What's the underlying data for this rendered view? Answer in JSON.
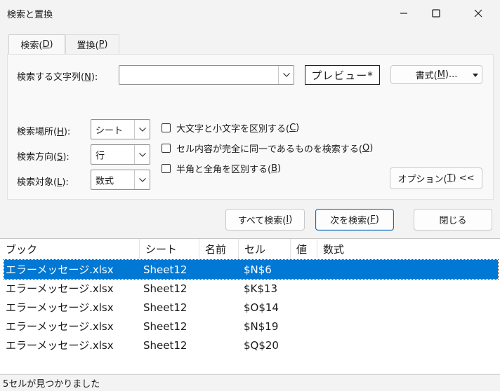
{
  "window": {
    "title": "検索と置換",
    "minimize_icon": "minimize-icon",
    "maximize_icon": "maximize-icon",
    "close_icon": "close-icon"
  },
  "tabs": [
    {
      "label": "検索(",
      "mnemonic": "D",
      "suffix": ")",
      "active": true
    },
    {
      "label": "置換(",
      "mnemonic": "P",
      "suffix": ")",
      "active": false
    }
  ],
  "search": {
    "label": "検索する文字列(",
    "mnemonic": "N",
    "suffix": "):",
    "value": "",
    "preview": "プレビュー*",
    "format_label": "書式(",
    "format_mnemonic": "M",
    "format_suffix": ")..."
  },
  "options": {
    "within_label": "検索場所(",
    "within_mnemonic": "H",
    "within_suffix": "):",
    "within_value": "シート",
    "direction_label": "検索方向(",
    "direction_mnemonic": "S",
    "direction_suffix": "):",
    "direction_value": "行",
    "lookin_label": "検索対象(",
    "lookin_mnemonic": "L",
    "lookin_suffix": "):",
    "lookin_value": "数式",
    "checkboxes": [
      {
        "label": "大文字と小文字を区別する(",
        "mnemonic": "C",
        "suffix": ")",
        "checked": false
      },
      {
        "label": "セル内容が完全に同一であるものを検索する(",
        "mnemonic": "O",
        "suffix": ")",
        "checked": false
      },
      {
        "label": "半角と全角を区別する(",
        "mnemonic": "B",
        "suffix": ")",
        "checked": false
      }
    ],
    "options_button": "オプション(",
    "options_mnemonic": "T",
    "options_suffix": ") <<"
  },
  "actions": {
    "find_all": "すべて検索(",
    "find_all_mnemonic": "I",
    "find_all_suffix": ")",
    "find_next": "次を検索(",
    "find_next_mnemonic": "F",
    "find_next_suffix": ")",
    "close": "閉じる"
  },
  "results": {
    "columns": [
      "ブック",
      "シート",
      "名前",
      "セル",
      "値",
      "数式"
    ],
    "rows": [
      {
        "book": "エラーメッセージ.xlsx",
        "sheet": "Sheet12",
        "name": "",
        "cell": "$N$6",
        "value": "",
        "formula": "",
        "selected": true
      },
      {
        "book": "エラーメッセージ.xlsx",
        "sheet": "Sheet12",
        "name": "",
        "cell": "$K$13",
        "value": "",
        "formula": "",
        "selected": false
      },
      {
        "book": "エラーメッセージ.xlsx",
        "sheet": "Sheet12",
        "name": "",
        "cell": "$O$14",
        "value": "",
        "formula": "",
        "selected": false
      },
      {
        "book": "エラーメッセージ.xlsx",
        "sheet": "Sheet12",
        "name": "",
        "cell": "$N$19",
        "value": "",
        "formula": "",
        "selected": false
      },
      {
        "book": "エラーメッセージ.xlsx",
        "sheet": "Sheet12",
        "name": "",
        "cell": "$Q$20",
        "value": "",
        "formula": "",
        "selected": false
      }
    ]
  },
  "status": "5セルが見つかりました",
  "colors": {
    "accent": "#0078d4",
    "primary_border": "#0f6cbd"
  }
}
